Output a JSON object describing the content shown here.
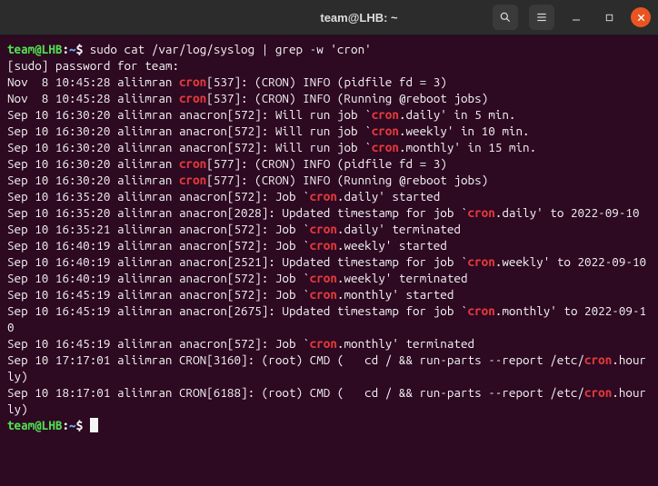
{
  "titlebar": {
    "title": "team@LHB: ~",
    "search_icon": "search-icon",
    "menu_icon": "hamburger-icon",
    "minimize_icon": "minimize-icon",
    "maximize_icon": "maximize-icon",
    "close_icon": "close-icon"
  },
  "prompt": {
    "user_host": "team@LHB",
    "path": "~",
    "symbol": "$"
  },
  "command": "sudo cat /var/log/syslog | grep -w 'cron'",
  "sudo_line": "[sudo] password for team:",
  "highlight_token": "cron",
  "lines": [
    {
      "pre": "Nov  8 10:45:28 aliimran ",
      "hl": "cron",
      "post": "[537]: (CRON) INFO (pidfile fd = 3)"
    },
    {
      "pre": "Nov  8 10:45:28 aliimran ",
      "hl": "cron",
      "post": "[537]: (CRON) INFO (Running @reboot jobs)"
    },
    {
      "pre": "Sep 10 16:30:20 aliimran anacron[572]: Will run job `",
      "hl": "cron",
      "post": ".daily' in 5 min."
    },
    {
      "pre": "Sep 10 16:30:20 aliimran anacron[572]: Will run job `",
      "hl": "cron",
      "post": ".weekly' in 10 min."
    },
    {
      "pre": "Sep 10 16:30:20 aliimran anacron[572]: Will run job `",
      "hl": "cron",
      "post": ".monthly' in 15 min."
    },
    {
      "pre": "Sep 10 16:30:20 aliimran ",
      "hl": "cron",
      "post": "[577]: (CRON) INFO (pidfile fd = 3)"
    },
    {
      "pre": "Sep 10 16:30:20 aliimran ",
      "hl": "cron",
      "post": "[577]: (CRON) INFO (Running @reboot jobs)"
    },
    {
      "pre": "Sep 10 16:35:20 aliimran anacron[572]: Job `",
      "hl": "cron",
      "post": ".daily' started"
    },
    {
      "pre": "Sep 10 16:35:20 aliimran anacron[2028]: Updated timestamp for job `",
      "hl": "cron",
      "post": ".daily' to 2022-09-10"
    },
    {
      "pre": "Sep 10 16:35:21 aliimran anacron[572]: Job `",
      "hl": "cron",
      "post": ".daily' terminated"
    },
    {
      "pre": "Sep 10 16:40:19 aliimran anacron[572]: Job `",
      "hl": "cron",
      "post": ".weekly' started"
    },
    {
      "pre": "Sep 10 16:40:19 aliimran anacron[2521]: Updated timestamp for job `",
      "hl": "cron",
      "post": ".weekly' to 2022-09-10"
    },
    {
      "pre": "Sep 10 16:40:19 aliimran anacron[572]: Job `",
      "hl": "cron",
      "post": ".weekly' terminated"
    },
    {
      "pre": "Sep 10 16:45:19 aliimran anacron[572]: Job `",
      "hl": "cron",
      "post": ".monthly' started"
    },
    {
      "pre": "Sep 10 16:45:19 aliimran anacron[2675]: Updated timestamp for job `",
      "hl": "cron",
      "post": ".monthly' to 2022-09-10"
    },
    {
      "pre": "Sep 10 16:45:19 aliimran anacron[572]: Job `",
      "hl": "cron",
      "post": ".monthly' terminated"
    },
    {
      "pre": "Sep 10 17:17:01 aliimran CRON[3160]: (root) CMD (   cd / && run-parts --report /etc/",
      "hl": "cron",
      "post": ".hourly)"
    },
    {
      "pre": "Sep 10 18:17:01 aliimran CRON[6188]: (root) CMD (   cd / && run-parts --report /etc/",
      "hl": "cron",
      "post": ".hourly)"
    }
  ]
}
